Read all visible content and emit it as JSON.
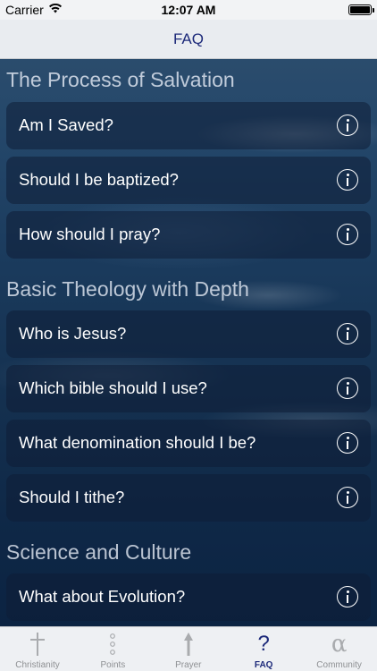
{
  "status_bar": {
    "carrier": "Carrier",
    "time": "12:07 AM"
  },
  "nav": {
    "title": "FAQ"
  },
  "sections": [
    {
      "title": "The Process of Salvation",
      "items": [
        {
          "label": "Am I Saved?",
          "icon": "info-icon"
        },
        {
          "label": "Should I be baptized?",
          "icon": "info-icon"
        },
        {
          "label": "How should I pray?",
          "icon": "info-icon"
        }
      ]
    },
    {
      "title": "Basic Theology with Depth",
      "items": [
        {
          "label": "Who is Jesus?",
          "icon": "info-icon"
        },
        {
          "label": "Which bible should I use?",
          "icon": "info-icon"
        },
        {
          "label": "What denomination should I be?",
          "icon": "info-icon"
        },
        {
          "label": "Should I tithe?",
          "icon": "info-icon"
        }
      ]
    },
    {
      "title": "Science and Culture",
      "items": [
        {
          "label": "What about Evolution?",
          "icon": "info-icon"
        }
      ]
    }
  ],
  "tabs": [
    {
      "label": "Christianity",
      "icon": "cross-icon",
      "active": false
    },
    {
      "label": "Points",
      "icon": "dots-icon",
      "active": false
    },
    {
      "label": "Prayer",
      "icon": "arrow-up-icon",
      "active": false
    },
    {
      "label": "FAQ",
      "icon": "question-icon",
      "active": true
    },
    {
      "label": "Community",
      "icon": "alpha-icon",
      "active": false
    }
  ],
  "colors": {
    "accent": "#1d2a7a",
    "tab_inactive": "#8e9093"
  }
}
